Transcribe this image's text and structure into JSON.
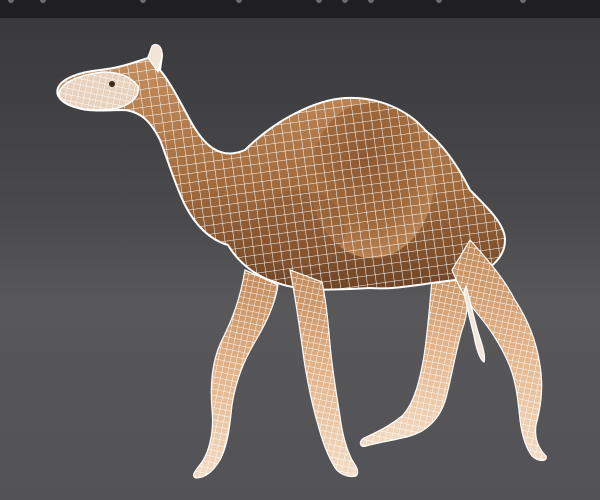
{
  "viewport": {
    "background_top": "#38383b",
    "background_horizon": "#58585b",
    "background_bottom": "#535357",
    "toolbar_color": "#1f1f21"
  },
  "model": {
    "subject_icon": "camel-wireframe-icon",
    "display_mode": "wireframe-on-shaded",
    "skin_color": "#b07a4a",
    "skin_shadow": "#6e4426",
    "skin_highlight": "#e3b48a",
    "wire_color": "#ffffff"
  }
}
